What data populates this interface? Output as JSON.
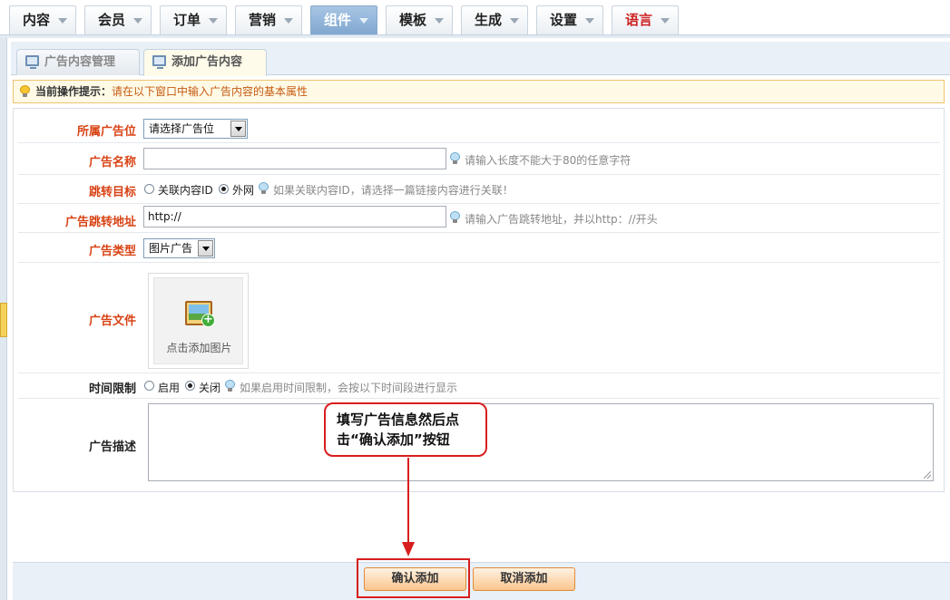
{
  "nav": {
    "tabs": [
      {
        "label": "内容"
      },
      {
        "label": "会员"
      },
      {
        "label": "订单"
      },
      {
        "label": "营销"
      },
      {
        "label": "组件",
        "active": true
      },
      {
        "label": "模板"
      },
      {
        "label": "生成"
      },
      {
        "label": "设置"
      },
      {
        "label": "语言",
        "color": "#cc2222"
      }
    ]
  },
  "subtabs": {
    "manage": "广告内容管理",
    "add": "添加广告内容"
  },
  "tip": {
    "title": "当前操作提示：",
    "text": "请在以下窗口中输入广告内容的基本属性"
  },
  "form": {
    "position": {
      "label": "所属广告位",
      "value": "请选择广告位"
    },
    "name": {
      "label": "广告名称",
      "value": "",
      "hint": "请输入长度不能大于80的任意字符"
    },
    "target": {
      "label": "跳转目标",
      "option_related": "关联内容ID",
      "option_external": "外网",
      "selected": "外网",
      "hint": "如果关联内容ID，请选择一篇链接内容进行关联！"
    },
    "url": {
      "label": "广告跳转地址",
      "value": "http://",
      "hint": "请输入广告跳转地址，并以http：//开头"
    },
    "type": {
      "label": "广告类型",
      "value": "图片广告"
    },
    "file": {
      "label": "广告文件",
      "upload_text": "点击添加图片"
    },
    "time_limit": {
      "label": "时间限制",
      "option_on": "启用",
      "option_off": "关闭",
      "selected": "关闭",
      "hint": "如果启用时间限制，会按以下时间段进行显示"
    },
    "description": {
      "label": "广告描述",
      "value": ""
    }
  },
  "callout": {
    "line1": "填写广告信息然后点",
    "line2": "击“确认添加”按钮"
  },
  "footer": {
    "confirm": "确认添加",
    "cancel": "取消添加"
  },
  "colors": {
    "accent_red": "#d81e1e",
    "label_orange": "#d84315",
    "active_tab": "#7fa7cf"
  }
}
